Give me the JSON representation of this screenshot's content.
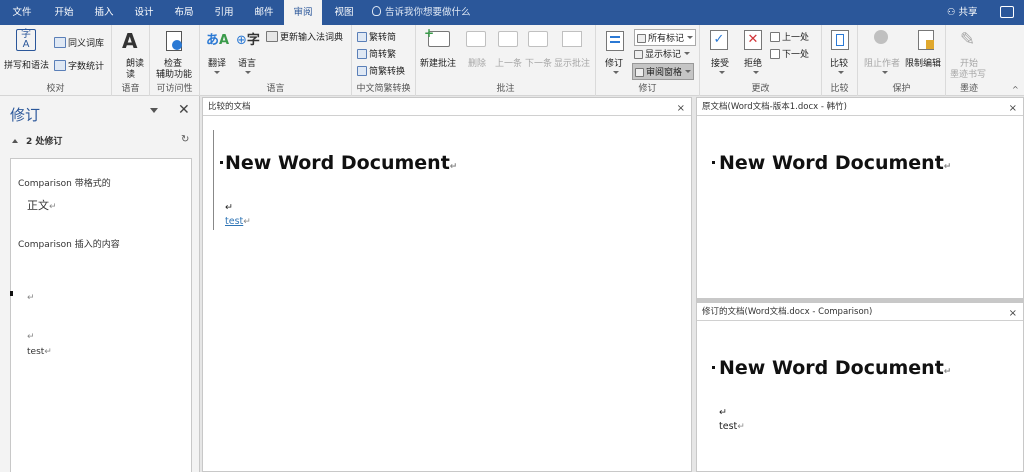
{
  "tabs": [
    "文件",
    "开始",
    "插入",
    "设计",
    "布局",
    "引用",
    "邮件",
    "审阅",
    "视图"
  ],
  "active_tab": "审阅",
  "tell_me": "告诉我你想要做什么",
  "share": "共享",
  "ribbon": {
    "proofing": {
      "spell": "拼写和语法",
      "thesaurus": "同义词库",
      "wordcount": "字数统计",
      "label": "校对"
    },
    "speech": {
      "read": "朗读",
      "read2": "读",
      "label": "语音"
    },
    "accessibility": {
      "check": "检查",
      "check2": "辅助功能",
      "label": "可访问性"
    },
    "language": {
      "translate": "翻译",
      "language": "语言",
      "ime": "更新输入法词典",
      "label": "语言"
    },
    "chinese": {
      "t2s": "繁转简",
      "s2t": "简转繁",
      "convert": "简繁转换",
      "label": "中文简繁转换"
    },
    "comments": {
      "new": "新建批注",
      "delete": "删除",
      "prev": "上一条",
      "next": "下一条",
      "show": "显示批注",
      "label": "批注"
    },
    "tracking": {
      "track": "修订",
      "markup": "所有标记",
      "show_markup": "显示标记",
      "pane": "审阅窗格",
      "label": "修订"
    },
    "changes": {
      "accept": "接受",
      "reject": "拒绝",
      "prev": "上一处",
      "next": "下一处",
      "label": "更改"
    },
    "compare": {
      "compare": "比较",
      "label": "比较"
    },
    "protect": {
      "block": "阻止作者",
      "restrict": "限制编辑",
      "label": "保护"
    },
    "ink": {
      "start": "开始",
      "start2": "墨迹书写",
      "label": "墨迹"
    }
  },
  "revisions_pane": {
    "title": "修订",
    "count": "2 处修订",
    "items": [
      {
        "author": "Comparison",
        "action": "带格式的",
        "detail": "正文"
      },
      {
        "author": "Comparison",
        "action": "插入的内容"
      }
    ],
    "para_mark": "↵",
    "test": "test"
  },
  "compared_doc": {
    "header": "比较的文档",
    "title": "New Word Document",
    "text": "test"
  },
  "original_doc": {
    "header": "原文档(Word文档-版本1.docx - 韩竹)",
    "title": "New Word Document"
  },
  "revised_doc": {
    "header": "修订的文档(Word文档.docx - Comparison)",
    "title": "New Word Document",
    "text": "test"
  },
  "colors": {
    "accent": "#2b579a",
    "link": "#2e74b5"
  }
}
